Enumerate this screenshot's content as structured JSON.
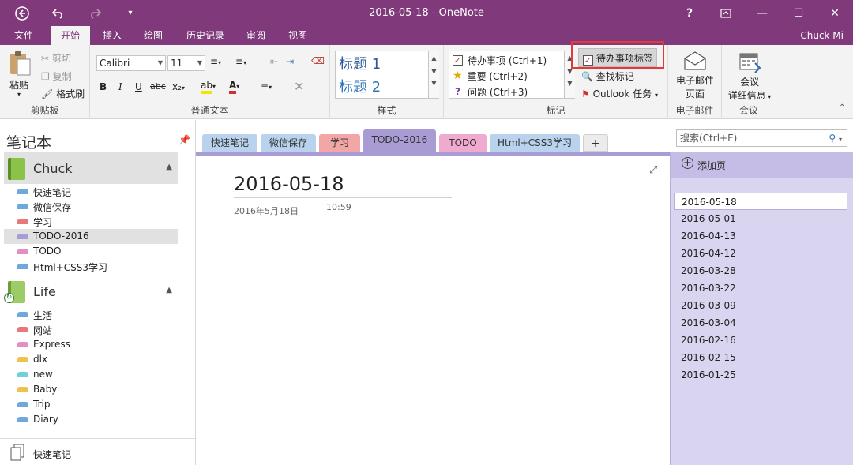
{
  "titlebar": {
    "title": "2016-05-18 - OneNote",
    "back_icon": "back-arrow-circle-icon",
    "undo_icon": "undo-icon",
    "redo_icon": "redo-icon",
    "qat_icon": "customize-quick-access-icon",
    "help": "?",
    "ribbon_display_icon": "ribbon-display-options-icon",
    "minimize": "—",
    "maximize": "☐",
    "close": "✕"
  },
  "ribbon_tabs": [
    "文件",
    "开始",
    "插入",
    "绘图",
    "历史记录",
    "审阅",
    "视图"
  ],
  "active_tab": "开始",
  "user": "Chuck Mi",
  "clipboard": {
    "paste": "粘贴",
    "cut": "剪切",
    "copy": "复制",
    "format_painter": "格式刷",
    "label": "剪贴板"
  },
  "basic_text": {
    "font": "Calibri",
    "size": "11",
    "bold": "B",
    "italic": "I",
    "underline": "U",
    "strikethrough": "abc",
    "subscript": "x₂",
    "label": "普通文本"
  },
  "styles": {
    "heading1": "标题 1",
    "heading2": "标题 2",
    "label": "样式"
  },
  "tags": {
    "items": [
      {
        "label": "待办事项 (Ctrl+1)",
        "icon": "todo-checkbox-icon"
      },
      {
        "label": "重要 (Ctrl+2)",
        "icon": "star-icon"
      },
      {
        "label": "问题 (Ctrl+3)",
        "icon": "question-icon"
      }
    ],
    "todo_tag": "待办事项标签",
    "find_tags": "查找标记",
    "outlook_tasks": "Outlook 任务",
    "label": "标记",
    "highlight_color": "#e53935"
  },
  "email": {
    "button": "电子邮件",
    "button2": "页面",
    "label": "电子邮件"
  },
  "meeting": {
    "button": "会议",
    "button2": "详细信息",
    "label": "会议"
  },
  "notebooks": {
    "heading": "笔记本",
    "list": [
      {
        "name": "Chuck",
        "color": "#8bc34a",
        "sections": [
          {
            "label": "快速笔记",
            "color": "#6fa8dc"
          },
          {
            "label": "微信保存",
            "color": "#6fa8dc"
          },
          {
            "label": "学习",
            "color": "#e8787a"
          },
          {
            "label": "TODO-2016",
            "color": "#a99bd4"
          },
          {
            "label": "TODO",
            "color": "#e48fbf"
          },
          {
            "label": "Html+CSS3学习",
            "color": "#6fa8dc"
          }
        ]
      },
      {
        "name": "Life",
        "color": "#9ccc65",
        "sections": [
          {
            "label": "生活",
            "color": "#6fa8dc"
          },
          {
            "label": "网站",
            "color": "#e8787a"
          },
          {
            "label": "Express",
            "color": "#e48fbf"
          },
          {
            "label": "dlx",
            "color": "#f0c14b"
          },
          {
            "label": "new",
            "color": "#6fd0d8"
          },
          {
            "label": "Baby",
            "color": "#f0c14b"
          },
          {
            "label": "Trip",
            "color": "#6fa8dc"
          },
          {
            "label": "Diary",
            "color": "#6fa8dc"
          }
        ]
      }
    ],
    "quick_notes": "快速笔记",
    "pin_icon": "pin-icon"
  },
  "section_tabs": [
    {
      "label": "快速笔记",
      "color": "#b9d2ee"
    },
    {
      "label": "微信保存",
      "color": "#b9d2ee"
    },
    {
      "label": "学习",
      "color": "#f2a6a6"
    },
    {
      "label": "TODO-2016",
      "color": "#a99bd4"
    },
    {
      "label": "TODO",
      "color": "#f0a9cf"
    },
    {
      "label": "Html+CSS3学习",
      "color": "#b9d2ee"
    },
    {
      "label": "+",
      "color": "#ececec"
    }
  ],
  "page": {
    "title": "2016-05-18",
    "date": "2016年5月18日",
    "time": "10:59",
    "expand_icon": "expand-icon"
  },
  "search": {
    "placeholder": "搜索(Ctrl+E)",
    "icon": "search-icon"
  },
  "pages": {
    "add": "添加页",
    "list": [
      "2016-05-18",
      "2016-05-01",
      "2016-04-13",
      "2016-04-12",
      "2016-03-28",
      "2016-03-22",
      "2016-03-09",
      "2016-03-04",
      "2016-02-16",
      "2016-02-15",
      "2016-01-25"
    ]
  }
}
